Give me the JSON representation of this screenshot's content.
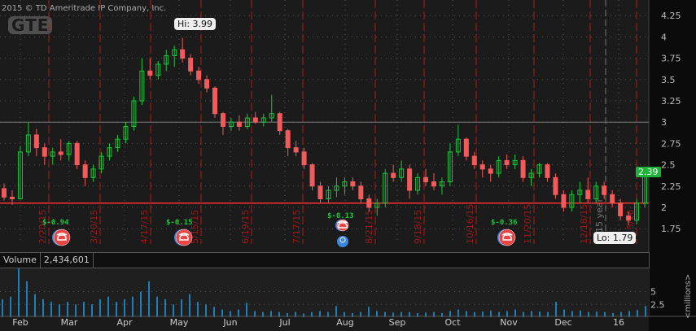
{
  "header": {
    "copyright": "2015 © TD Ameritrade IP Company, Inc.",
    "logo": "GTE"
  },
  "colors": {
    "up": "#1cc43c",
    "down": "#f25b5b",
    "volume": "#1d7fb8",
    "expiry_line": "#b01818",
    "background": "#1b1b1b"
  },
  "price_panel": {
    "hi_label": "Hi: 3.99",
    "lo_label": "Lo: 1.79",
    "last_price": "2.39",
    "reference_line": 3.0,
    "support_line": 2.05,
    "year_label": "2015 year"
  },
  "earnings": [
    {
      "label": "$-0.94",
      "icon": "phone-icon"
    },
    {
      "label": "$-0.15",
      "icon": "phone-icon"
    },
    {
      "label": "$-0.13",
      "icon": "phone-icon",
      "extra_icon": "lightbulb-icon"
    },
    {
      "label": "$-0.36",
      "icon": "phone-icon"
    }
  ],
  "expiry_dates": [
    "2/20/15",
    "3/20/15",
    "4/17/15",
    "5/15/15",
    "6/19/15",
    "7/17/15",
    "8/21/15",
    "9/18/15",
    "10/16/15",
    "11/20/15",
    "12/18/15",
    "1/15/16"
  ],
  "volume_panel": {
    "title": "Volume",
    "value": "2,434,601",
    "unit": "<millions>"
  },
  "chart_data": [
    {
      "type": "candlestick",
      "ylim": [
        1.6,
        4.35
      ],
      "yticks": [
        "4.25",
        "4",
        "3.75",
        "3.5",
        "3.25",
        "3",
        "2.75",
        "2.5",
        "2.25",
        "2",
        "1.75"
      ],
      "xticks": [
        "Feb",
        "Mar",
        "Apr",
        "May",
        "Jun",
        "Jul",
        "Aug",
        "Sep",
        "Oct",
        "Nov",
        "Dec",
        "16"
      ],
      "ohlc": [
        [
          2.22,
          2.28,
          2.08,
          2.12
        ],
        [
          2.12,
          2.2,
          2.03,
          2.1
        ],
        [
          2.1,
          2.72,
          2.1,
          2.65
        ],
        [
          2.65,
          3.0,
          2.6,
          2.85
        ],
        [
          2.85,
          2.92,
          2.6,
          2.7
        ],
        [
          2.7,
          2.75,
          2.5,
          2.6
        ],
        [
          2.6,
          2.7,
          2.5,
          2.65
        ],
        [
          2.65,
          2.8,
          2.55,
          2.62
        ],
        [
          2.62,
          2.78,
          2.55,
          2.75
        ],
        [
          2.75,
          2.78,
          2.45,
          2.5
        ],
        [
          2.5,
          2.55,
          2.25,
          2.35
        ],
        [
          2.35,
          2.5,
          2.3,
          2.45
        ],
        [
          2.45,
          2.65,
          2.4,
          2.6
        ],
        [
          2.6,
          2.75,
          2.55,
          2.7
        ],
        [
          2.7,
          2.85,
          2.65,
          2.8
        ],
        [
          2.8,
          3.0,
          2.75,
          2.95
        ],
        [
          2.95,
          3.3,
          2.9,
          3.25
        ],
        [
          3.25,
          3.75,
          3.2,
          3.6
        ],
        [
          3.6,
          3.75,
          3.5,
          3.55
        ],
        [
          3.55,
          3.72,
          3.5,
          3.68
        ],
        [
          3.68,
          3.85,
          3.6,
          3.78
        ],
        [
          3.78,
          3.9,
          3.65,
          3.85
        ],
        [
          3.85,
          3.99,
          3.7,
          3.75
        ],
        [
          3.75,
          3.8,
          3.55,
          3.6
        ],
        [
          3.6,
          3.65,
          3.45,
          3.5
        ],
        [
          3.5,
          3.55,
          3.35,
          3.4
        ],
        [
          3.4,
          3.42,
          3.05,
          3.1
        ],
        [
          3.1,
          3.12,
          2.85,
          2.95
        ],
        [
          2.95,
          3.05,
          2.9,
          3.0
        ],
        [
          3.0,
          3.08,
          2.9,
          2.95
        ],
        [
          2.95,
          3.1,
          2.92,
          3.05
        ],
        [
          3.05,
          3.12,
          2.98,
          3.0
        ],
        [
          3.0,
          3.1,
          2.95,
          3.05
        ],
        [
          3.05,
          3.32,
          3.0,
          3.1
        ],
        [
          3.1,
          3.12,
          2.85,
          2.9
        ],
        [
          2.9,
          2.92,
          2.6,
          2.7
        ],
        [
          2.7,
          2.78,
          2.6,
          2.65
        ],
        [
          2.65,
          2.7,
          2.45,
          2.5
        ],
        [
          2.5,
          2.52,
          2.2,
          2.25
        ],
        [
          2.25,
          2.3,
          2.05,
          2.1
        ],
        [
          2.1,
          2.25,
          2.05,
          2.2
        ],
        [
          2.2,
          2.35,
          2.12,
          2.25
        ],
        [
          2.25,
          2.35,
          2.15,
          2.3
        ],
        [
          2.3,
          2.35,
          2.2,
          2.25
        ],
        [
          2.25,
          2.3,
          2.05,
          2.1
        ],
        [
          2.1,
          2.15,
          1.95,
          2.0
        ],
        [
          2.0,
          2.1,
          1.9,
          2.05
        ],
        [
          2.05,
          2.45,
          2.0,
          2.4
        ],
        [
          2.4,
          2.5,
          2.3,
          2.35
        ],
        [
          2.35,
          2.55,
          2.3,
          2.45
        ],
        [
          2.45,
          2.5,
          2.1,
          2.2
        ],
        [
          2.2,
          2.4,
          2.15,
          2.35
        ],
        [
          2.35,
          2.45,
          2.25,
          2.3
        ],
        [
          2.3,
          2.4,
          2.2,
          2.25
        ],
        [
          2.25,
          2.35,
          2.15,
          2.3
        ],
        [
          2.3,
          2.75,
          2.25,
          2.65
        ],
        [
          2.65,
          2.97,
          2.6,
          2.8
        ],
        [
          2.8,
          2.82,
          2.55,
          2.6
        ],
        [
          2.6,
          2.65,
          2.45,
          2.5
        ],
        [
          2.5,
          2.55,
          2.35,
          2.45
        ],
        [
          2.45,
          2.5,
          2.3,
          2.4
        ],
        [
          2.4,
          2.6,
          2.35,
          2.55
        ],
        [
          2.55,
          2.62,
          2.45,
          2.5
        ],
        [
          2.5,
          2.62,
          2.45,
          2.55
        ],
        [
          2.55,
          2.6,
          2.3,
          2.35
        ],
        [
          2.35,
          2.45,
          2.25,
          2.4
        ],
        [
          2.4,
          2.52,
          2.35,
          2.5
        ],
        [
          2.5,
          2.52,
          2.3,
          2.35
        ],
        [
          2.35,
          2.4,
          2.1,
          2.15
        ],
        [
          2.15,
          2.2,
          1.95,
          2.0
        ],
        [
          2.0,
          2.2,
          1.95,
          2.15
        ],
        [
          2.15,
          2.3,
          2.05,
          2.2
        ],
        [
          2.2,
          2.35,
          2.05,
          2.1
        ],
        [
          2.1,
          2.3,
          2.05,
          2.25
        ],
        [
          2.25,
          2.3,
          2.1,
          2.15
        ],
        [
          2.15,
          2.2,
          2.0,
          2.05
        ],
        [
          2.05,
          2.1,
          1.85,
          1.9
        ],
        [
          1.9,
          1.95,
          1.79,
          1.85
        ],
        [
          1.85,
          2.1,
          1.8,
          2.05
        ],
        [
          2.05,
          2.4,
          2.0,
          2.39
        ]
      ]
    },
    {
      "type": "bar",
      "ylim": [
        0,
        10
      ],
      "yticks": [
        "5",
        "2.5"
      ],
      "unit": "millions",
      "values": [
        3.5,
        4,
        9.5,
        7,
        4.5,
        3.5,
        3,
        2.5,
        3,
        2.5,
        3,
        2.5,
        3.5,
        4,
        3,
        3.5,
        4,
        5,
        7,
        4,
        3.5,
        2.5,
        3.5,
        4.5,
        3,
        2.5,
        2,
        1.5,
        1.2,
        1.5,
        2.8,
        1.2,
        1,
        1.2,
        1,
        0.8,
        1,
        0.7,
        1,
        1.2,
        1,
        2.2,
        1,
        0.8,
        1,
        2,
        1.2,
        1,
        0.9,
        1,
        1,
        0.8,
        0.9,
        1,
        0.8,
        1.2,
        1.5,
        1.2,
        1,
        1.1,
        1.3,
        1,
        1.2,
        1.5,
        1,
        1.2,
        1.1,
        1,
        3,
        1.5,
        1.2,
        1.3,
        1,
        1.1,
        1,
        0.8,
        1,
        1.2,
        1.4,
        2.2
      ]
    }
  ]
}
